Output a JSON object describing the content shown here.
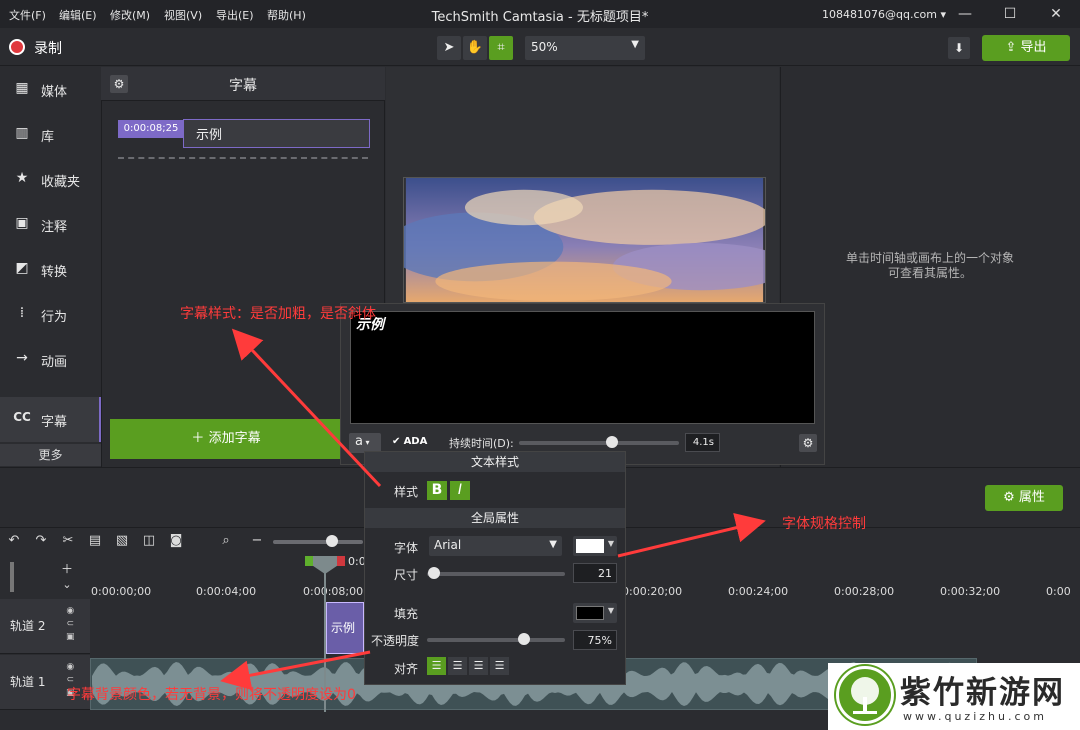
{
  "menu": {
    "file": "文件(F)",
    "edit": "编辑(E)",
    "modify": "修改(M)",
    "view": "视图(V)",
    "export": "导出(E)",
    "help": "帮助(H)"
  },
  "app_title": "TechSmith Camtasia - 无标题项目*",
  "account": "108481076@qq.com",
  "toolbar": {
    "record_label": "录制",
    "zoom": "50%",
    "export_label": "导出"
  },
  "sidebar": {
    "items": [
      {
        "label": "媒体",
        "icon": "film-icon"
      },
      {
        "label": "库",
        "icon": "library-icon"
      },
      {
        "label": "收藏夹",
        "icon": "star-icon"
      },
      {
        "label": "注释",
        "icon": "annotation-icon"
      },
      {
        "label": "转换",
        "icon": "transition-icon"
      },
      {
        "label": "行为",
        "icon": "behavior-icon"
      },
      {
        "label": "动画",
        "icon": "animation-icon"
      },
      {
        "label": "字幕",
        "icon": "cc-icon"
      }
    ],
    "more": "更多"
  },
  "captions": {
    "title": "字幕",
    "entry_time": "0:00:08;25",
    "entry_text": "示例",
    "add_label": "添加字幕"
  },
  "properties": {
    "hint_line1": "单击时间轴或画布上的一个对象",
    "hint_line2": "可查看其属性。",
    "button": "属性"
  },
  "caption_editor": {
    "preview_text": "示例",
    "ada": "ADA",
    "duration_label": "持续时间(D):",
    "duration_value": "4.1s",
    "duration_fraction": 0.58
  },
  "text_style": {
    "section_title": "文本样式",
    "style_label": "样式",
    "bold": "B",
    "italic": "I",
    "global_title": "全局属性",
    "font_label": "字体",
    "font_value": "Arial",
    "font_color": "#ffffff",
    "size_label": "尺寸",
    "size_value": "21",
    "size_fraction": 0.05,
    "fill_label": "填充",
    "fill_color": "#000000",
    "opacity_label": "不透明度",
    "opacity_value": "75%",
    "opacity_fraction": 0.7,
    "align_label": "对齐"
  },
  "timeline": {
    "playhead_time": "0:0",
    "ticks": [
      "0:00:00;00",
      "0:00:04;00",
      "0:00:08;00",
      "0:00:20;00",
      "0:00:24;00",
      "0:00:28;00",
      "0:00:32;00",
      "0:00"
    ],
    "track2": "轨道 2",
    "track1": "轨道 1",
    "clip_caption": "示例"
  },
  "annotations": {
    "style_note": "字幕样式：是否加粗，是否斜体",
    "font_note": "字体规格控制",
    "bg_note": "字幕背景颜色，若无背景，则将不透明度设为0"
  },
  "watermark": {
    "name": "紫竹新游网",
    "url": "www.quzizhu.com"
  },
  "colors": {
    "accent_green": "#5a9e20",
    "caption_purple": "#7d6ac7",
    "annotation_red": "#ff3b3b"
  }
}
